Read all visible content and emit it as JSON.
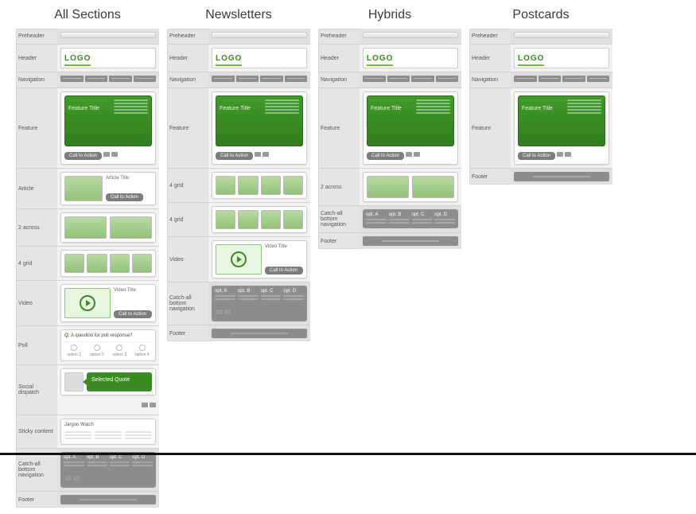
{
  "columns": {
    "all": "All Sections",
    "news": "Newsletters",
    "hyb": "Hybrids",
    "post": "Postcards"
  },
  "labels": {
    "preheader": "Preheader",
    "header": "Header",
    "navigation": "Navigation",
    "feature": "Feature",
    "article": "Article",
    "two_across": "2 across",
    "four_grid": "4 grid",
    "video": "Video",
    "poll": "Poll",
    "social": "Social dispatch",
    "sticky": "Sticky content",
    "catchall": "Catch-all bottom navigation",
    "footer": "Footer"
  },
  "logo": "LOGO",
  "feature_title": "Feature Title",
  "cta": "Call to Action",
  "article_title": "Article Title",
  "video_title": "Video Title",
  "poll": {
    "prefix": "Q:",
    "question": "A question for poll response?",
    "options": [
      "option 1",
      "option 2",
      "option 3",
      "option 4"
    ]
  },
  "social_quote": "Selected Quote",
  "jargon": "Jargon Watch",
  "catch_opts": [
    "opt. A",
    "opt. B",
    "opt. C",
    "opt. D"
  ]
}
